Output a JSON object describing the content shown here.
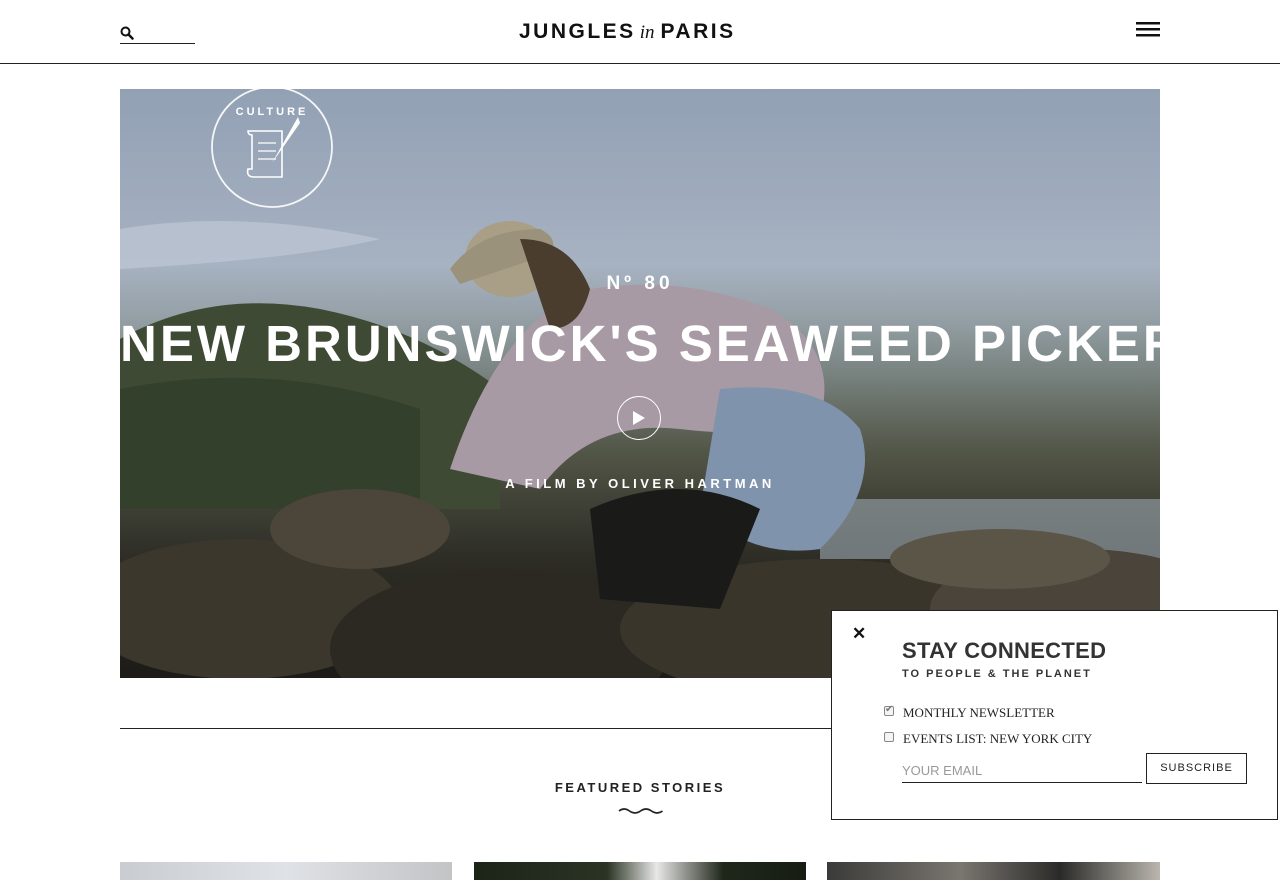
{
  "header": {
    "logo_left": "JUNGLES",
    "logo_mid": "in",
    "logo_right": "PARIS",
    "search_placeholder": ""
  },
  "hero": {
    "badge_text": "CULTURE",
    "issue": "Nº 80",
    "title": "NEW BRUNSWICK'S SEAWEED PICKERS",
    "byline": "A FILM BY OLIVER HARTMAN"
  },
  "featured": {
    "heading": "FEATURED STORIES"
  },
  "popup": {
    "title": "STAY CONNECTED",
    "subtitle": "TO PEOPLE & THE PLANET",
    "options": [
      {
        "label": "MONTHLY NEWSLETTER",
        "checked": true
      },
      {
        "label": "EVENTS LIST: NEW YORK CITY",
        "checked": false
      }
    ],
    "email_placeholder": "YOUR EMAIL",
    "subscribe_label": "SUBSCRIBE",
    "close_label": "✕"
  },
  "icons": [
    "search-icon",
    "menu-icon",
    "play-icon",
    "close-icon",
    "wave-icon",
    "scroll-quill-icon"
  ],
  "colors": {
    "text": "#111111",
    "border": "#222222",
    "hero_text": "#ffffff"
  }
}
